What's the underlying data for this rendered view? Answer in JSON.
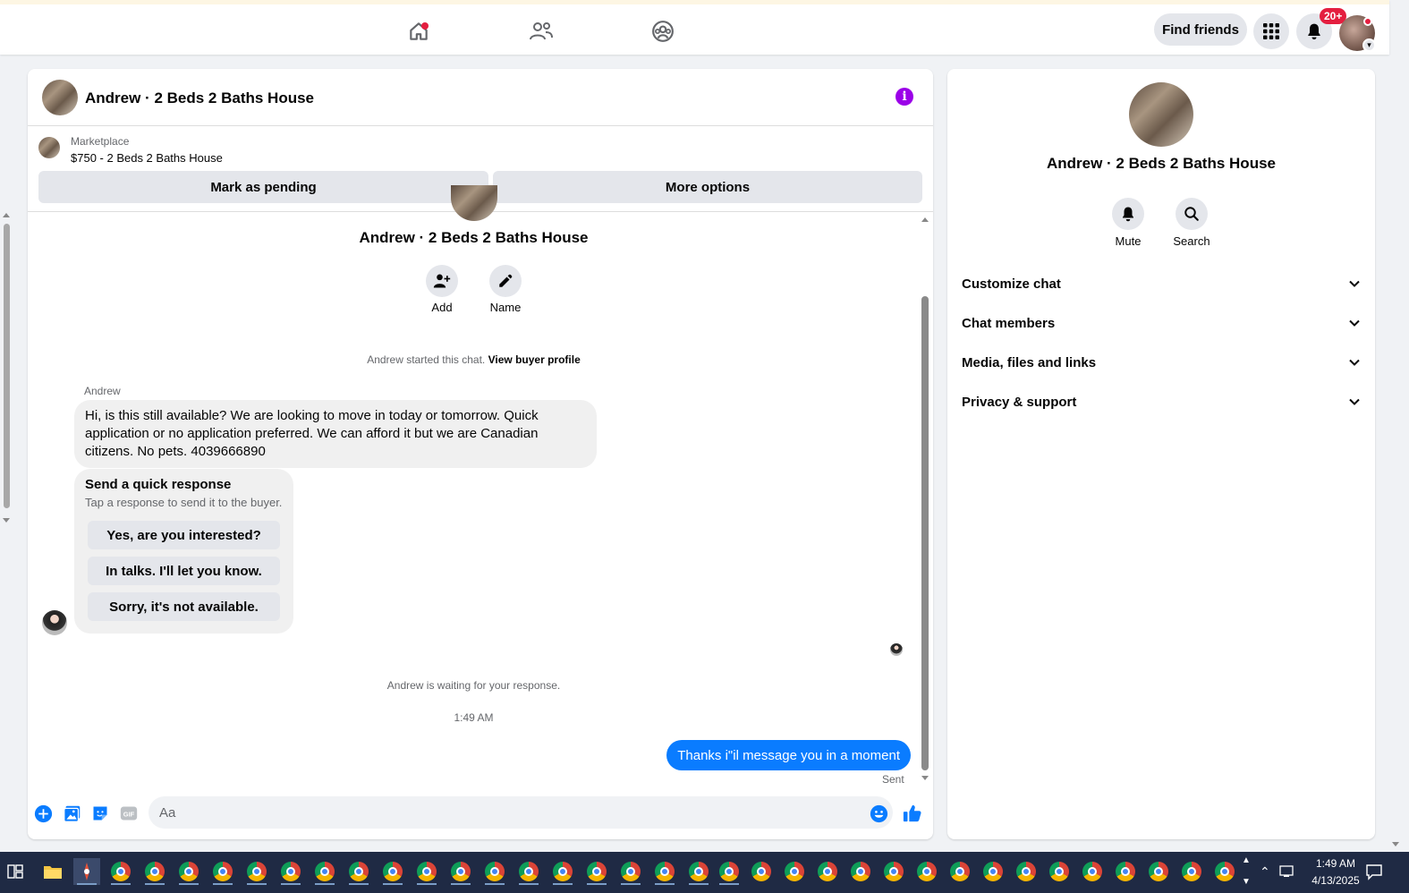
{
  "topbar": {
    "find_friends": "Find friends",
    "notification_badge": "20+",
    "nav_icons": [
      "home-icon",
      "friends-icon",
      "groups-icon"
    ]
  },
  "chat": {
    "header_title": "Andrew · 2 Beds 2 Baths House",
    "marketplace_label": "Marketplace",
    "listing": "$750 - 2 Beds 2 Baths House",
    "mark_pending": "Mark as pending",
    "more_options": "More options",
    "center_name": "Andrew · 2 Beds 2 Baths House",
    "add_label": "Add",
    "name_label": "Name",
    "started_text": "Andrew started this chat.",
    "view_profile": "View buyer profile",
    "sender": "Andrew",
    "message": "Hi, is this still available? We are looking to move in today or tomorrow. Quick application or no application preferred. We can afford it but we are Canadian citizens. No pets. 4039666890",
    "quick_response_title": "Send a quick response",
    "quick_response_sub": "Tap a response to send it to the buyer.",
    "quick_responses": [
      "Yes, are you interested?",
      "In talks. I'll let you know.",
      "Sorry, it's not available."
    ],
    "waiting_text": "Andrew is waiting for your response.",
    "timestamp": "1:49 AM",
    "outgoing": "Thanks i\"il message you in a moment",
    "sent_status": "Sent",
    "composer_placeholder": "Aa"
  },
  "info": {
    "name": "Andrew · 2 Beds 2 Baths House",
    "mute": "Mute",
    "search": "Search",
    "sections": [
      "Customize chat",
      "Chat members",
      "Media, files and links",
      "Privacy & support"
    ]
  },
  "taskbar": {
    "time": "1:49 AM",
    "date": "4/13/2025"
  },
  "colors": {
    "accent_blue": "#0a7cff",
    "info_purple": "#9b00e8",
    "badge_red": "#e41e3f"
  }
}
